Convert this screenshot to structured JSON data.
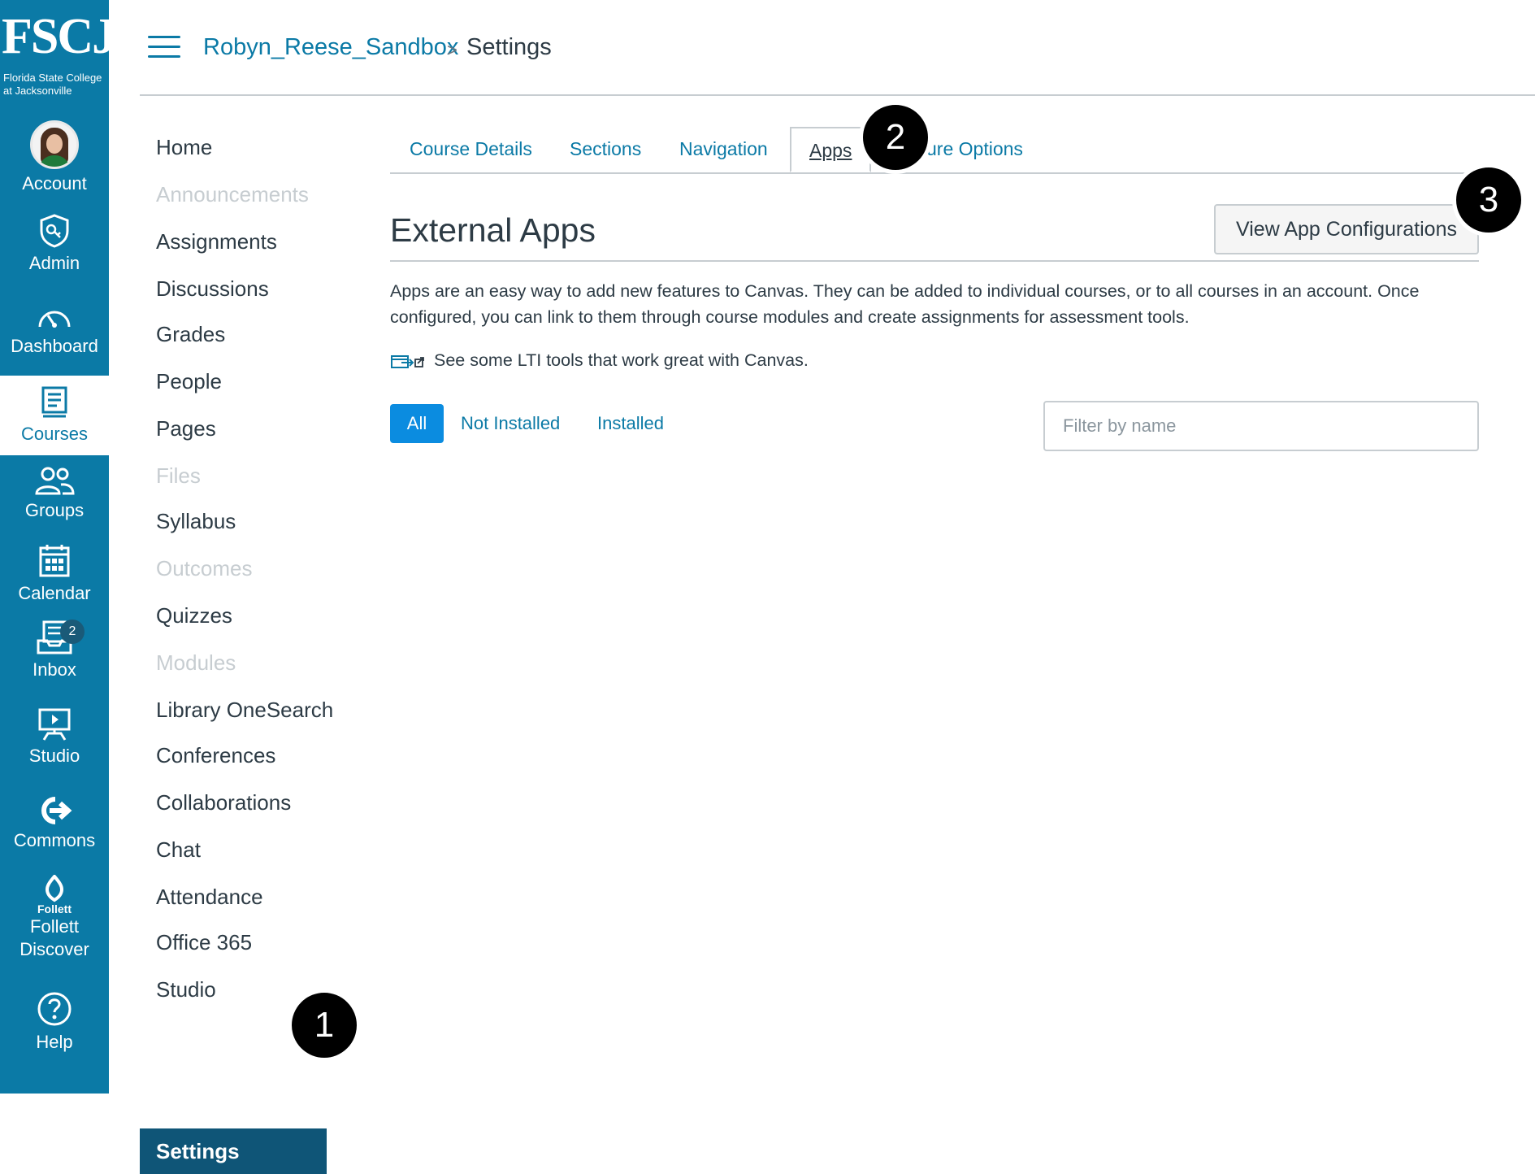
{
  "logo": {
    "name": "FSCJ",
    "subtitle": "Florida State College at Jacksonville"
  },
  "global_nav": [
    {
      "label": "Account",
      "icon": "avatar"
    },
    {
      "label": "Admin",
      "icon": "shield-icon"
    },
    {
      "label": "Dashboard",
      "icon": "gauge-icon"
    },
    {
      "label": "Courses",
      "icon": "book-icon",
      "active": true
    },
    {
      "label": "Groups",
      "icon": "people-icon"
    },
    {
      "label": "Calendar",
      "icon": "calendar-icon"
    },
    {
      "label": "Inbox",
      "icon": "inbox-icon",
      "badge": "2"
    },
    {
      "label": "Studio",
      "icon": "presentation-icon"
    },
    {
      "label": "Commons",
      "icon": "share-arrow-icon"
    },
    {
      "label": "Follett\nDiscover",
      "icon": "follett-icon",
      "icon_text": "Follett"
    },
    {
      "label": "Help",
      "icon": "question-icon"
    }
  ],
  "breadcrumb": {
    "course": "Robyn_Reese_Sandbox",
    "separator": ">",
    "current": "Settings"
  },
  "course_nav": [
    {
      "label": "Home",
      "hidden": false
    },
    {
      "label": "Announcements",
      "hidden": true
    },
    {
      "label": "Assignments",
      "hidden": false
    },
    {
      "label": "Discussions",
      "hidden": false
    },
    {
      "label": "Grades",
      "hidden": false
    },
    {
      "label": "People",
      "hidden": false
    },
    {
      "label": "Pages",
      "hidden": false
    },
    {
      "label": "Files",
      "hidden": true
    },
    {
      "label": "Syllabus",
      "hidden": false
    },
    {
      "label": "Outcomes",
      "hidden": true
    },
    {
      "label": "Quizzes",
      "hidden": false
    },
    {
      "label": "Modules",
      "hidden": true
    },
    {
      "label": "Library OneSearch",
      "hidden": false
    },
    {
      "label": "Conferences",
      "hidden": false
    },
    {
      "label": "Collaborations",
      "hidden": false
    },
    {
      "label": "Chat",
      "hidden": false
    },
    {
      "label": "Attendance",
      "hidden": false
    },
    {
      "label": "Office 365",
      "hidden": false
    },
    {
      "label": "Studio",
      "hidden": false
    },
    {
      "label": "Settings",
      "active": true
    }
  ],
  "tabs": [
    {
      "label": "Course Details"
    },
    {
      "label": "Sections"
    },
    {
      "label": "Navigation"
    },
    {
      "label": "Apps",
      "active": true
    },
    {
      "label": "ure Options"
    }
  ],
  "main": {
    "title": "External Apps",
    "view_config_button": "View App Configurations",
    "description": "Apps are an easy way to add new features to Canvas. They can be added to individual courses, or to all courses in an account. Once configured, you can link to them through course modules and create assignments for assessment tools.",
    "lti_link": "See some LTI tools that work great with Canvas.",
    "filters": [
      "All",
      "Not Installed",
      "Installed"
    ],
    "search_placeholder": "Filter by name"
  },
  "callouts": [
    "1",
    "2",
    "3"
  ],
  "colors": {
    "nav_bg": "#0b7aa6",
    "link": "#0b7aa6",
    "active_course_nav": "#0f5577",
    "primary_button": "#0b8ce0"
  }
}
